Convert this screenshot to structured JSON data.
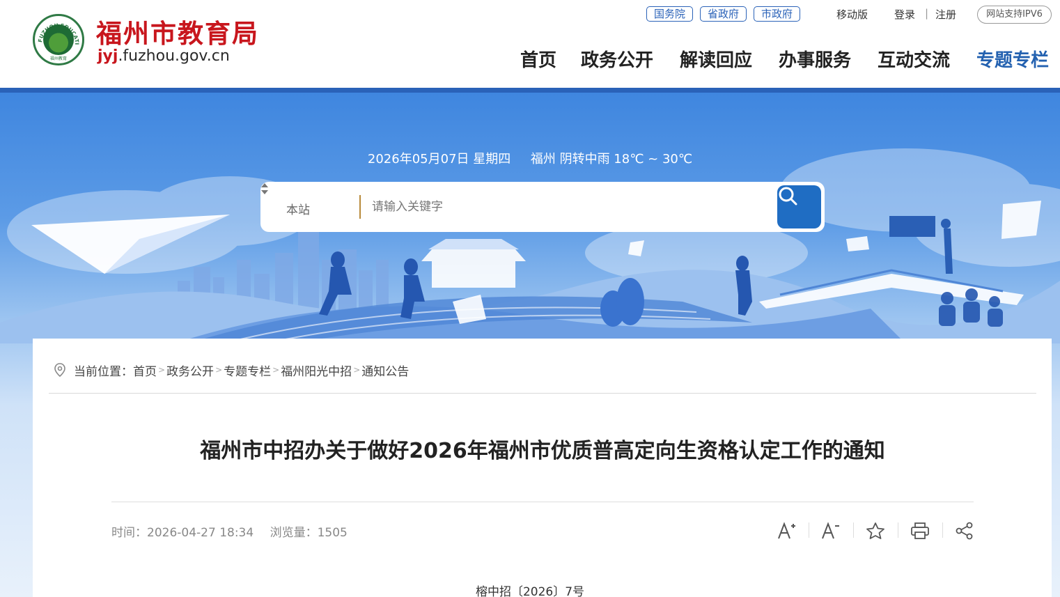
{
  "header": {
    "logo_cn": "福州市教育局",
    "logo_url_hl": "jyj",
    "logo_url_rest": ".fuzhou.gov.cn",
    "logo_ring_text": "FUZHOU EDUCATION",
    "logo_bottom_text": "福州教育",
    "gov_links": [
      "国务院",
      "省政府",
      "市政府"
    ],
    "mobile": "移动版",
    "login": "登录",
    "separator": "|",
    "register": "注册",
    "ipv6": "网站支持IPV6",
    "nav": [
      "首页",
      "政务公开",
      "解读回应",
      "办事服务",
      "互动交流",
      "专题专栏"
    ],
    "nav_active_index": 5,
    "brand_color": "#c8161d",
    "accent_color": "#2a62b8"
  },
  "banner": {
    "date": "2026年05月07日 星期四",
    "weather": "福州 阴转中雨 18℃ ~ 30℃",
    "search_scope": "本站",
    "search_placeholder": "请输入关键字"
  },
  "breadcrumb": {
    "label": "当前位置：",
    "items": [
      "首页",
      "政务公开",
      "专题专栏",
      "福州阳光中招",
      "通知公告"
    ],
    "divider": ">"
  },
  "article": {
    "title": "福州市中招办关于做好2026年福州市优质普高定向生资格认定工作的通知",
    "time_label": "时间：",
    "time_value": "2026-04-27 18:34",
    "views_label": "浏览量：",
    "views_value": "1505",
    "tools": [
      "font-increase-icon",
      "font-decrease-icon",
      "star-icon",
      "print-icon",
      "share-icon"
    ],
    "doc_number": "榕中招〔2026〕7号"
  }
}
